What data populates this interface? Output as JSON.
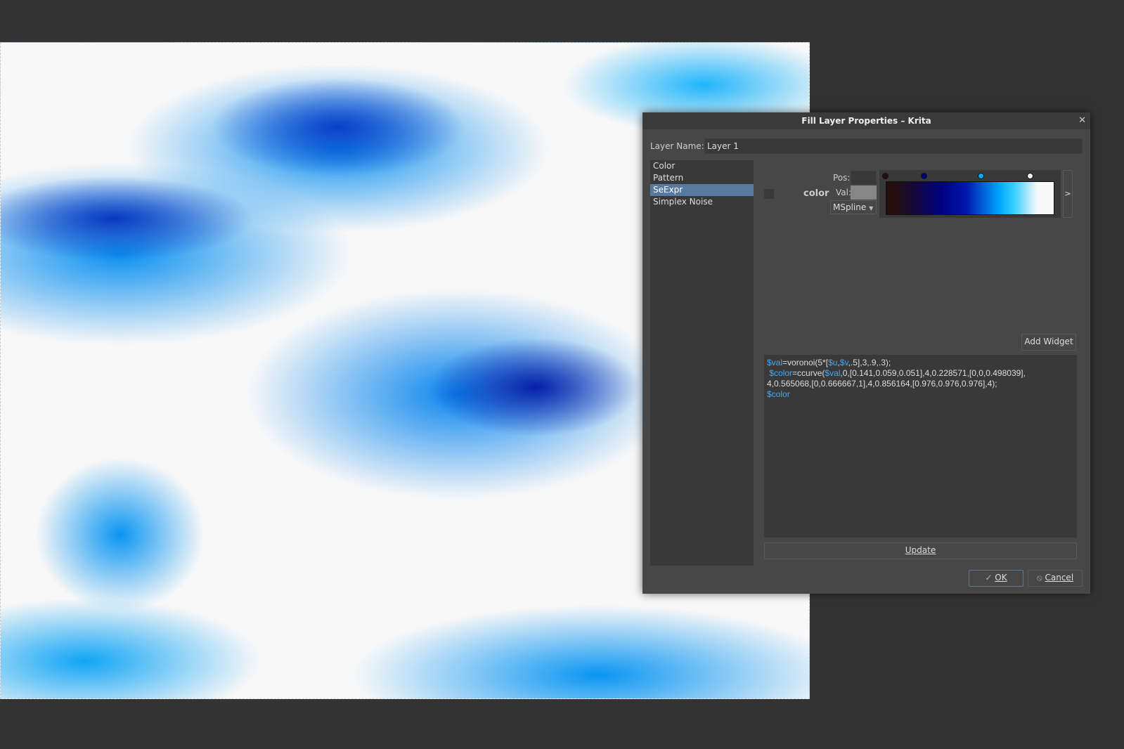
{
  "dialog": {
    "title": "Fill Layer Properties – Krita",
    "layer_name_label": "Layer Name:",
    "layer_name_value": "Layer 1",
    "fill_types": [
      "Color",
      "Pattern",
      "SeExpr",
      "Simplex Noise"
    ],
    "selected": "SeExpr",
    "widget": {
      "name": "color",
      "pos_label": "Pos:",
      "val_label": "Val:",
      "interp": "MSpline",
      "expand": ">"
    },
    "add_widget": "Add Widget",
    "code": {
      "l1a": "$val",
      "l1b": "=voronoi(5*[",
      "l1c": "$u",
      "l1d": ",",
      "l1e": "$v",
      "l1f": ",.5],3,.9,.3);",
      "l2a": "$color",
      "l2b": "=ccurve(",
      "l2c": "$val",
      "l2d": ",0,[0.141,0.059,0.051],4,0.228571,[0,0,0.498039],",
      "l3": "4,0.565068,[0,0.666667,1],4,0.856164,[0.976,0.976,0.976],4);",
      "l4": "$color"
    },
    "update": "Update",
    "ok": "OK",
    "cancel": "Cancel"
  },
  "colors": {
    "stop1": "#240f0d",
    "stop2": "#00007f",
    "stop3": "#00aaff",
    "stop4": "#f9f9f9"
  }
}
